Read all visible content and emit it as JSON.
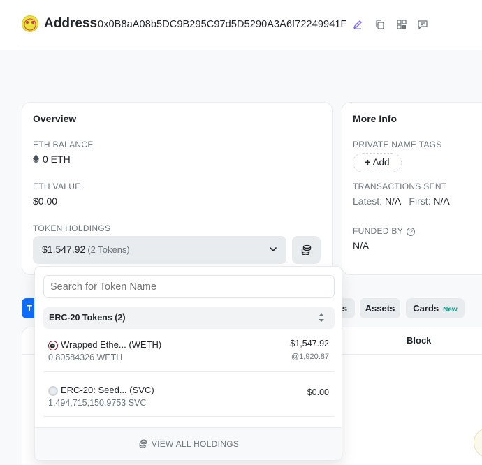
{
  "header": {
    "title": "Address",
    "address": "0x0B8aA08b5DC9B295C97d5D5290A3A6f72249941F",
    "icons": [
      "edit-icon",
      "copy-icon",
      "qr-code-icon",
      "comment-icon"
    ]
  },
  "overview": {
    "title": "Overview",
    "eth_balance_label": "ETH BALANCE",
    "eth_balance": "0 ETH",
    "eth_value_label": "ETH VALUE",
    "eth_value": "$0.00",
    "token_holdings_label": "TOKEN HOLDINGS",
    "token_total": "$1,547.92",
    "token_count": "(2 Tokens)"
  },
  "more_info": {
    "title": "More Info",
    "private_tags_label": "PRIVATE NAME TAGS",
    "add_label": "Add",
    "tx_sent_label": "TRANSACTIONS SENT",
    "latest_label": "Latest:",
    "latest_value": "N/A",
    "first_label": "First:",
    "first_value": "N/A",
    "funded_by_label": "FUNDED BY",
    "funded_by_value": "N/A"
  },
  "tabs": {
    "first_partial": "T",
    "partial": "s",
    "assets": "Assets",
    "cards": "Cards",
    "cards_badge": "New"
  },
  "table": {
    "block_header": "Block"
  },
  "dropdown": {
    "search_placeholder": "Search for Token Name",
    "group_title": "ERC-20 Tokens (2)",
    "tokens": [
      {
        "name": "Wrapped Ethe... (WETH)",
        "balance": "0.80584326 WETH",
        "value": "$1,547.92",
        "price": "@1,920.87",
        "icon": "weth-icon"
      },
      {
        "name": "ERC-20: Seed... (SVC)",
        "balance": "1,494,715,150.9753 SVC",
        "value": "$0.00",
        "price": "",
        "icon": "token-placeholder-icon"
      }
    ],
    "footer_label": "VIEW ALL HOLDINGS"
  },
  "colors": {
    "accent": "#0d6efd",
    "badge_green": "#00a186",
    "edit_icon": "#7b61ff"
  }
}
